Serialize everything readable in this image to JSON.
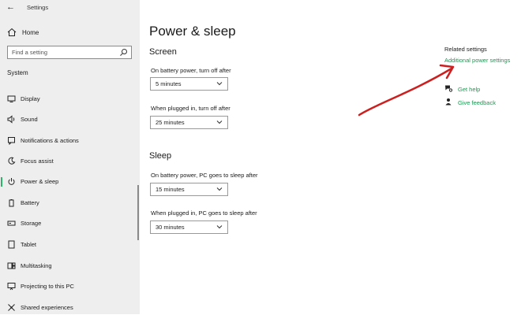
{
  "window": {
    "title": "Settings"
  },
  "sidebar": {
    "home_label": "Home",
    "search_placeholder": "Find a setting",
    "section": "System",
    "items": [
      {
        "label": "Display",
        "icon": "display-icon"
      },
      {
        "label": "Sound",
        "icon": "sound-icon"
      },
      {
        "label": "Notifications & actions",
        "icon": "notifications-icon"
      },
      {
        "label": "Focus assist",
        "icon": "focus-assist-icon"
      },
      {
        "label": "Power & sleep",
        "icon": "power-icon",
        "selected": true
      },
      {
        "label": "Battery",
        "icon": "battery-icon"
      },
      {
        "label": "Storage",
        "icon": "storage-icon"
      },
      {
        "label": "Tablet",
        "icon": "tablet-icon"
      },
      {
        "label": "Multitasking",
        "icon": "multitasking-icon"
      },
      {
        "label": "Projecting to this PC",
        "icon": "projecting-icon"
      },
      {
        "label": "Shared experiences",
        "icon": "shared-experiences-icon"
      }
    ]
  },
  "main": {
    "title": "Power & sleep",
    "screen": {
      "heading": "Screen",
      "battery_label": "On battery power, turn off after",
      "battery_value": "5 minutes",
      "plugged_label": "When plugged in, turn off after",
      "plugged_value": "25 minutes"
    },
    "sleep": {
      "heading": "Sleep",
      "battery_label": "On battery power, PC goes to sleep after",
      "battery_value": "15 minutes",
      "plugged_label": "When plugged in, PC goes to sleep after",
      "plugged_value": "30 minutes"
    }
  },
  "related": {
    "title": "Related settings",
    "additional_power": "Additional power settings",
    "get_help": "Get help",
    "give_feedback": "Give feedback"
  },
  "colors": {
    "accent": "#1a9a50",
    "sidebar_bg": "#eeeeee",
    "annotation": "#cc2020"
  }
}
